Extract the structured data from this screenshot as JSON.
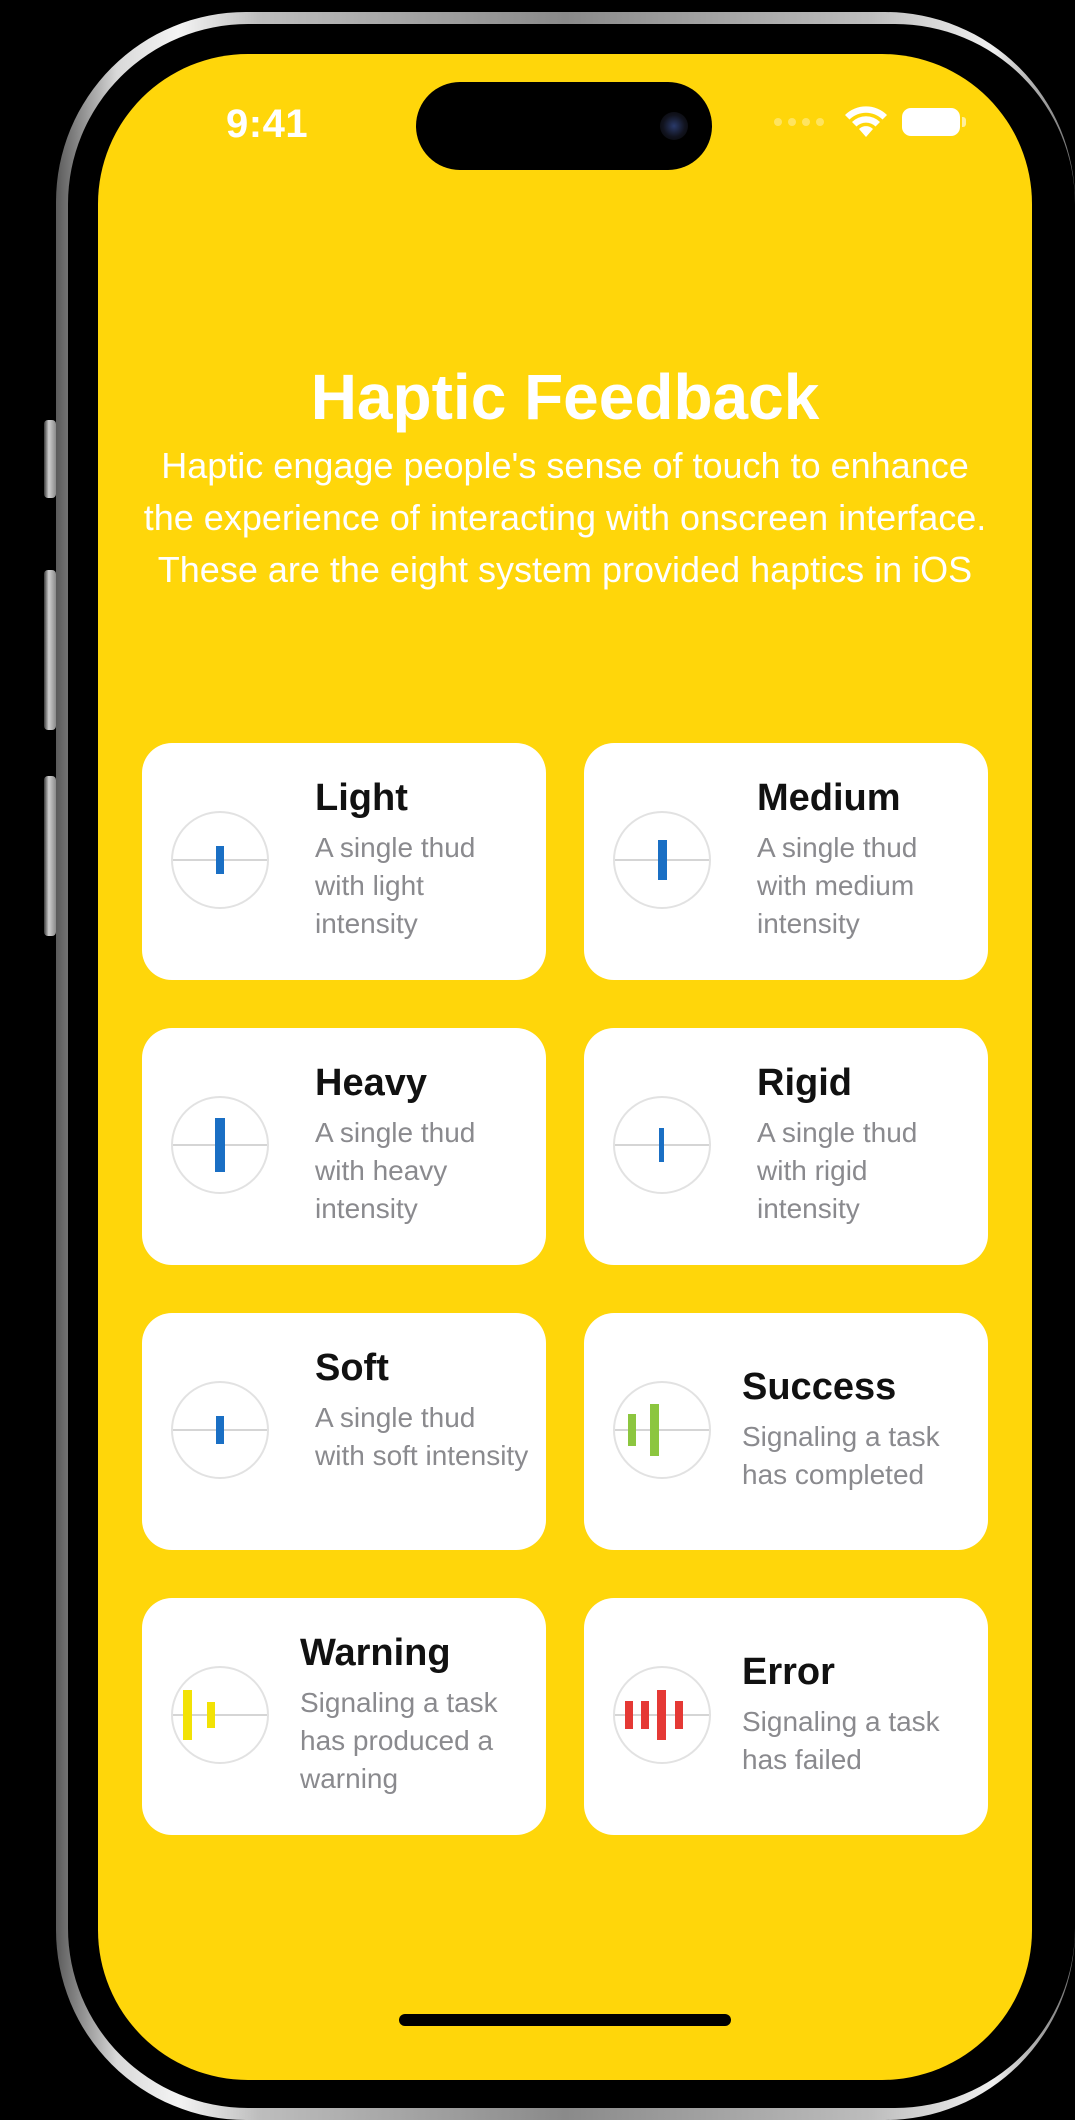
{
  "status_bar": {
    "time": "9:41"
  },
  "header": {
    "title": "Haptic Feedback",
    "subtitle": "Haptic engage people's sense of touch to enhance the experience of interacting with onscreen interface. These are the eight system provided haptics in iOS"
  },
  "colors": {
    "background": "#FFD60A",
    "impact": "#1A6FC4",
    "success": "#8CC63F",
    "warning": "#F2E205",
    "error": "#E53935"
  },
  "haptics": [
    {
      "title": "Light",
      "description": "A single thud with light intensity",
      "icon": "impact-light-icon"
    },
    {
      "title": "Medium",
      "description": "A single thud with medium intensity",
      "icon": "impact-medium-icon"
    },
    {
      "title": "Heavy",
      "description": "A single thud with heavy intensity",
      "icon": "impact-heavy-icon"
    },
    {
      "title": "Rigid",
      "description": "A single thud with rigid intensity",
      "icon": "impact-rigid-icon"
    },
    {
      "title": "Soft",
      "description": "A single thud with soft intensity",
      "icon": "impact-soft-icon"
    },
    {
      "title": "Success",
      "description": "Signaling a task has completed",
      "icon": "success-waveform-icon"
    },
    {
      "title": "Warning",
      "description": "Signaling a task has produced a warning",
      "icon": "warning-waveform-icon"
    },
    {
      "title": "Error",
      "description": "Signaling a task has failed",
      "icon": "error-waveform-icon"
    }
  ]
}
